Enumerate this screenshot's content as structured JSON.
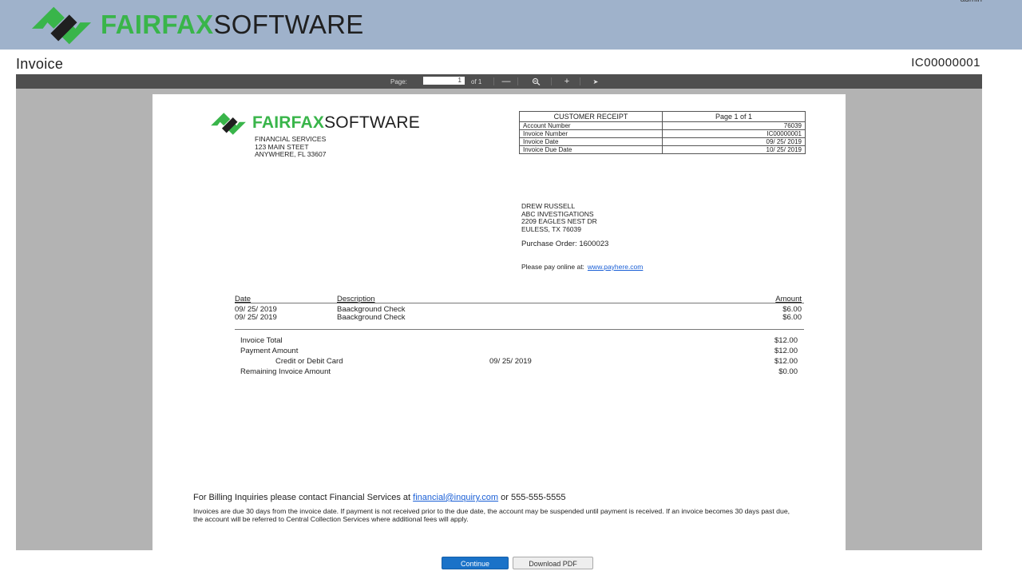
{
  "header": {
    "brand_bold": "FAIRFAX",
    "brand_light": "SOFTWARE",
    "user": "admin",
    "colors": {
      "bar": "#9fb2cb",
      "brand_green": "#39b54a",
      "brand_dark": "#1f1f1f"
    }
  },
  "page": {
    "title": "Invoice",
    "invoice_id": "IC00000001"
  },
  "viewer": {
    "page_label": "Page:",
    "page_value": "1",
    "page_of": "of 1",
    "icons": [
      "zoom-out-icon",
      "zoom-reset-icon",
      "zoom-in-icon",
      "pointer-icon"
    ],
    "zoom_out_glyph": "—",
    "zoom_in_glyph": "+",
    "pointer_glyph": "➤"
  },
  "document": {
    "brand_bold": "FAIRFAX",
    "brand_light": "SOFTWARE",
    "address": "FINANCIAL SERVICES\n123 MAIN STEET\nANYWHERE, FL 33607",
    "receipt": {
      "title": "CUSTOMER RECEIPT",
      "page": "Page 1 of 1",
      "rows": [
        {
          "label": "Account Number",
          "value": "76039"
        },
        {
          "label": "Invoice Number",
          "value": "IC00000001"
        },
        {
          "label": "Invoice Date",
          "value": "09/ 25/ 2019"
        },
        {
          "label": "Invoice Due Date",
          "value": "10/ 25/ 2019"
        }
      ]
    },
    "bill_to": "DREW RUSSELL\nABC INVESTIGATIONS\n2209 EAGLES NEST DR\nEULESS, TX 76039",
    "purchase_order": "Purchase Order: 1600023",
    "pay_online_label": "Please pay online at:",
    "pay_online_link": "www.payhere.com",
    "items_header": {
      "date": "Date",
      "description": "Description",
      "amount": "Amount"
    },
    "items": [
      {
        "date": "09/ 25/ 2019",
        "description": "Baackground Check",
        "amount": "$6.00"
      },
      {
        "date": "09/ 25/ 2019",
        "description": "Baackground Check",
        "amount": "$6.00"
      }
    ],
    "totals": {
      "invoice_total_label": "Invoice Total",
      "invoice_total": "$12.00",
      "payment_amount_label": "Payment Amount",
      "payment_amount": "$12.00",
      "payment_method_label": "Credit or Debit Card",
      "payment_method_date": "09/ 25/ 2019",
      "payment_method_amount": "$12.00",
      "remaining_label": "Remaining Invoice Amount",
      "remaining": "$0.00"
    },
    "footer": {
      "contact_prefix": "For Billing Inquiries please contact Financial Services at",
      "contact_email": "financial@inquiry.com",
      "contact_suffix": "or 555-555-5555",
      "notice": "Invoices are due 30 days from the invoice date. If payment is not received prior to the due date, the account may be suspended until payment is received. If an invoice becomes 30 days past due, the account will be referred to Central Collection Services where additional fees will apply."
    }
  },
  "buttons": {
    "continue": "Continue",
    "download": "Download PDF"
  }
}
